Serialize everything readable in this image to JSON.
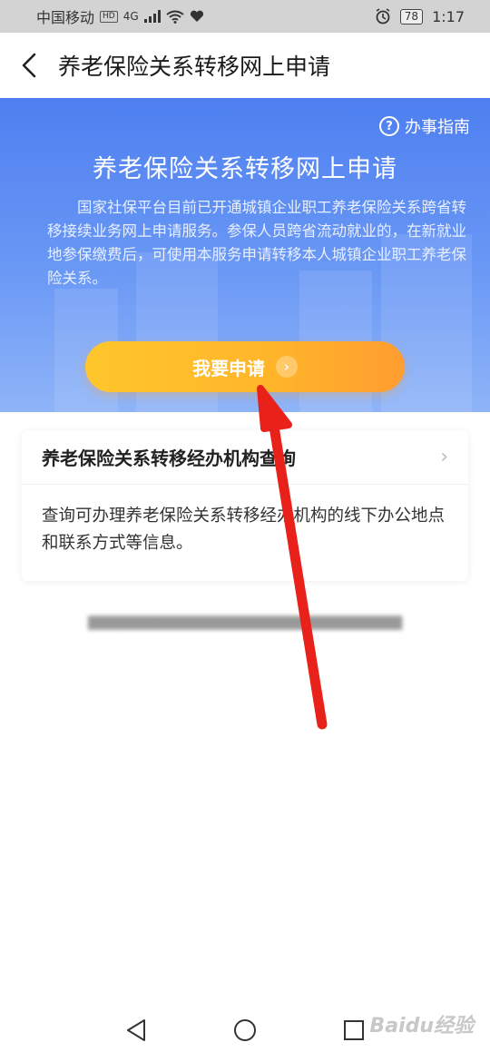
{
  "status_bar": {
    "carrier": "中国移动",
    "net_badge": "HD",
    "net_type": "4G",
    "battery": "78",
    "time": "1:17"
  },
  "nav": {
    "back_icon": "chevron-left-icon",
    "title": "养老保险关系转移网上申请"
  },
  "hero": {
    "guide_label": "办事指南",
    "guide_icon": "question-circle-icon",
    "title": "养老保险关系转移网上申请",
    "description": "国家社保平台目前已开通城镇企业职工养老保险关系跨省转移接续业务网上申请服务。参保人员跨省流动就业的，在新就业地参保缴费后，可使用本服务申请转移本人城镇企业职工养老保险关系。",
    "apply_button": "我要申请",
    "colors": {
      "gradient_top": "#4e7ff0",
      "gradient_bottom": "#8fb4f8",
      "button_start": "#ffc72c",
      "button_end": "#ff9d30"
    }
  },
  "card": {
    "title": "养老保险关系转移经办机构查询",
    "description": "查询可办理养老保险关系转移经办机构的线下办公地点和联系方式等信息。"
  },
  "annotation": {
    "arrow_color": "#e8211b"
  },
  "system_nav": {
    "back": "triangle-back-icon",
    "home": "circle-home-icon",
    "recent": "square-recent-icon"
  },
  "watermark": "Baidu经验"
}
